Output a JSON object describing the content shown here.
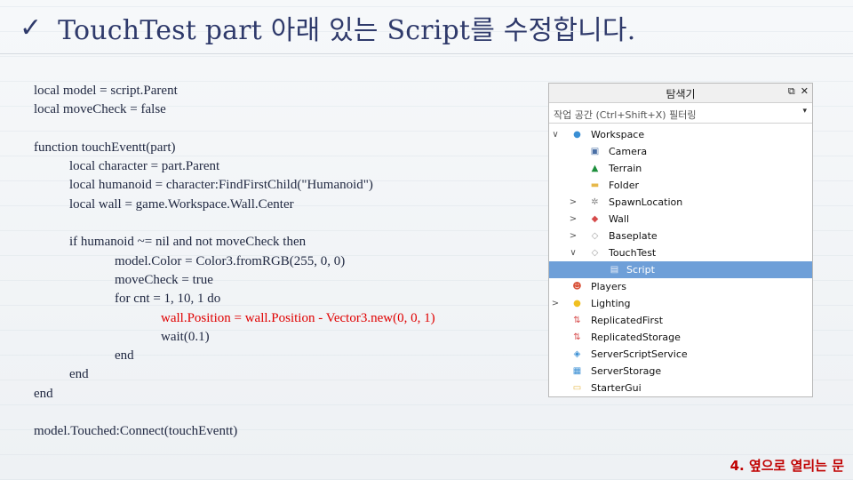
{
  "slide": {
    "check_glyph": "✓",
    "title": "TouchTest part 아래 있는 Script를 수정합니다.",
    "footer": "4. 옆으로 열리는 문"
  },
  "code_lines": [
    {
      "text": "local model = script.Parent",
      "indent": 0,
      "red": false
    },
    {
      "text": "local moveCheck = false",
      "indent": 0,
      "red": false
    },
    {
      "text": "",
      "indent": 0,
      "red": false
    },
    {
      "text": "function touchEventt(part)",
      "indent": 0,
      "red": false
    },
    {
      "text": "local character = part.Parent",
      "indent": 1,
      "red": false
    },
    {
      "text": "local humanoid = character:FindFirstChild(\"Humanoid\")",
      "indent": 1,
      "red": false
    },
    {
      "text": "local wall = game.Workspace.Wall.Center",
      "indent": 1,
      "red": false
    },
    {
      "text": "",
      "indent": 0,
      "red": false
    },
    {
      "text": "if humanoid ~= nil and not moveCheck then",
      "indent": 1,
      "red": false
    },
    {
      "text": "model.Color = Color3.fromRGB(255, 0, 0)",
      "indent": 2,
      "red": false
    },
    {
      "text": "moveCheck = true",
      "indent": 2,
      "red": false
    },
    {
      "text": "for cnt = 1, 10, 1 do",
      "indent": 2,
      "red": false
    },
    {
      "text": "wall.Position = wall.Position - Vector3.new(0, 0, 1)",
      "indent": 3,
      "red": true
    },
    {
      "text": "wait(0.1)",
      "indent": 3,
      "red": false
    },
    {
      "text": "end",
      "indent": 2,
      "red": false
    },
    {
      "text": "end",
      "indent": 1,
      "red": false
    },
    {
      "text": "end",
      "indent": 0,
      "red": false
    },
    {
      "text": "",
      "indent": 0,
      "red": false
    },
    {
      "text": "model.Touched:Connect(touchEventt)",
      "indent": 0,
      "red": false
    }
  ],
  "explorer": {
    "title": "탐색기",
    "dock_icon": "⧉",
    "close_icon": "✕",
    "filter_placeholder": "작업 공간 (Ctrl+Shift+X) 필터링",
    "filter_arrow": "▾",
    "items": [
      {
        "label": "Workspace",
        "level": 0,
        "caret": "∨",
        "icon": "workspace-globe-icon",
        "color": "#3a8fd4",
        "selected": false
      },
      {
        "label": "Camera",
        "level": 1,
        "caret": "",
        "icon": "camera-icon",
        "color": "#4a6fa5",
        "selected": false
      },
      {
        "label": "Terrain",
        "level": 1,
        "caret": "",
        "icon": "terrain-icon",
        "color": "#1d8f3c",
        "selected": false
      },
      {
        "label": "Folder",
        "level": 1,
        "caret": "",
        "icon": "folder-icon",
        "color": "#e6b84a",
        "selected": false
      },
      {
        "label": "SpawnLocation",
        "level": 1,
        "caret": ">",
        "icon": "spawn-location-icon",
        "color": "#888888",
        "selected": false
      },
      {
        "label": "Wall",
        "level": 1,
        "caret": ">",
        "icon": "model-icon",
        "color": "#d64b4b",
        "selected": false
      },
      {
        "label": "Baseplate",
        "level": 1,
        "caret": ">",
        "icon": "part-icon",
        "color": "#a0a0a0",
        "selected": false
      },
      {
        "label": "TouchTest",
        "level": 1,
        "caret": "∨",
        "icon": "part-icon",
        "color": "#a0a0a0",
        "selected": false
      },
      {
        "label": "Script",
        "level": 2,
        "caret": "",
        "icon": "script-icon",
        "color": "#e8eef8",
        "selected": true
      },
      {
        "label": "Players",
        "level": 0,
        "caret": "",
        "icon": "players-icon",
        "color": "#d9533a",
        "selected": false
      },
      {
        "label": "Lighting",
        "level": 0,
        "caret": ">",
        "icon": "lighting-bulb-icon",
        "color": "#f0c020",
        "selected": false
      },
      {
        "label": "ReplicatedFirst",
        "level": 0,
        "caret": "",
        "icon": "replicated-first-icon",
        "color": "#d64b4b",
        "selected": false
      },
      {
        "label": "ReplicatedStorage",
        "level": 0,
        "caret": "",
        "icon": "replicated-storage-icon",
        "color": "#d64b4b",
        "selected": false
      },
      {
        "label": "ServerScriptService",
        "level": 0,
        "caret": "",
        "icon": "server-script-service-icon",
        "color": "#3a8fd4",
        "selected": false
      },
      {
        "label": "ServerStorage",
        "level": 0,
        "caret": "",
        "icon": "server-storage-icon",
        "color": "#3a8fd4",
        "selected": false
      },
      {
        "label": "StarterGui",
        "level": 0,
        "caret": "",
        "icon": "starter-gui-icon",
        "color": "#e6b84a",
        "selected": false
      }
    ]
  }
}
